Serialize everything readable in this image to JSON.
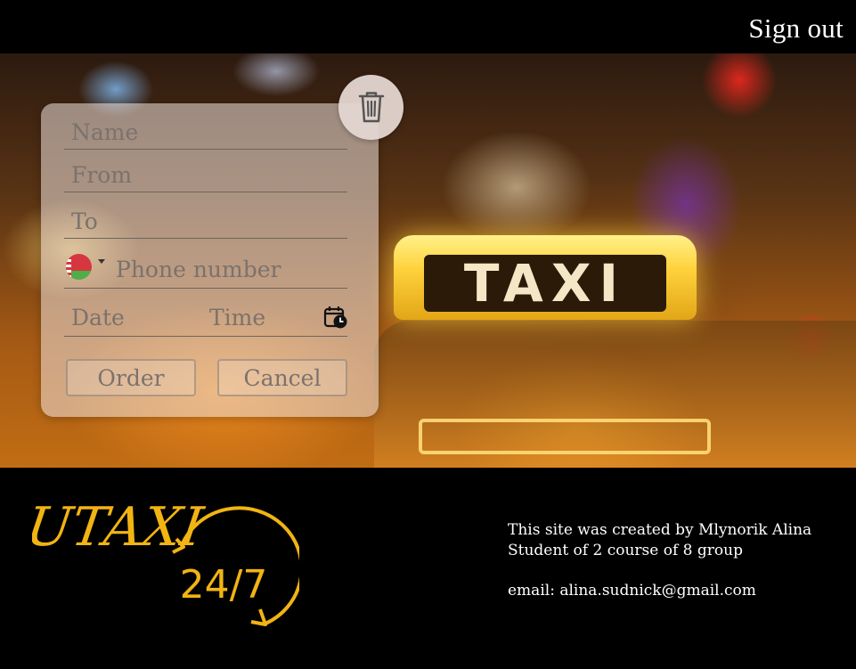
{
  "header": {
    "signout_label": "Sign out"
  },
  "hero": {
    "sign_text": "TAXI"
  },
  "order_form": {
    "name_placeholder": "Name",
    "from_placeholder": "From",
    "to_placeholder": "To",
    "phone_country": "Belarus",
    "phone_placeholder": "Phone number",
    "date_placeholder": "Date",
    "time_placeholder": "Time",
    "order_label": "Order",
    "cancel_label": "Cancel",
    "clear_icon": "trash-icon",
    "datetime_icon": "calendar-clock-icon"
  },
  "footer": {
    "logo_text": "UTAXI",
    "logo_hours": "24/7",
    "credit_line1": "This site was created by Mlynorik Alina",
    "credit_line2": "Student of 2 course of 8 group",
    "email_line": "email: alina.sudnick@gmail.com"
  },
  "colors": {
    "accent": "#f2b413",
    "background": "#000000",
    "card": "#eee2dc"
  }
}
